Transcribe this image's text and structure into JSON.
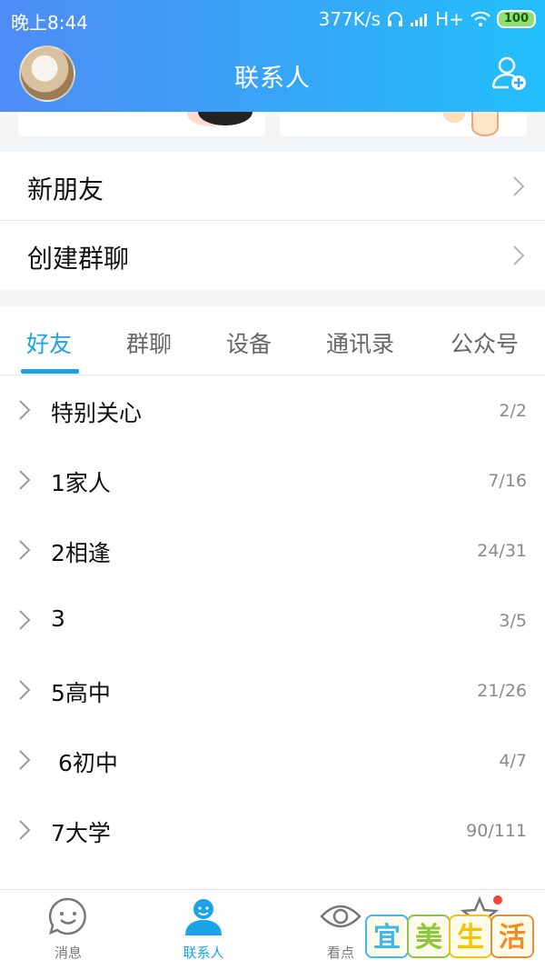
{
  "status_bar": {
    "time": "晚上8:44",
    "speed": "377K/s",
    "network": "H+",
    "battery": "100"
  },
  "header": {
    "title": "联系人"
  },
  "menu": [
    {
      "label": "新朋友"
    },
    {
      "label": "创建群聊"
    }
  ],
  "tabs": [
    {
      "label": "好友",
      "active": true
    },
    {
      "label": "群聊"
    },
    {
      "label": "设备"
    },
    {
      "label": "通讯录"
    },
    {
      "label": "公众号"
    }
  ],
  "groups": [
    {
      "name": "特别关心",
      "count": "2/2"
    },
    {
      "name": "1家人",
      "count": "7/16"
    },
    {
      "name": "2相逢",
      "count": "24/31"
    },
    {
      "name": "3",
      "count": "3/5"
    },
    {
      "name": "5高中",
      "count": "21/26"
    },
    {
      "name": " 6初中",
      "count": "4/7"
    },
    {
      "name": "7大学",
      "count": "90/111"
    }
  ],
  "bottom_nav": [
    {
      "label": "消息",
      "icon": "message-bubble-icon"
    },
    {
      "label": "联系人",
      "icon": "contacts-person-icon",
      "active": true
    },
    {
      "label": "看点",
      "icon": "eye-icon"
    },
    {
      "label": "",
      "icon": "star-icon",
      "badge": true
    }
  ],
  "watermark": {
    "chars": [
      "宜",
      "美",
      "生",
      "活"
    ],
    "colors": [
      "#3db8e8",
      "#8cc63f",
      "#f5c400",
      "#f08c28"
    ]
  },
  "colors": {
    "accent": "#1aa3e8",
    "header_start": "#4f8cf6",
    "header_end": "#22c0fb",
    "badge": "#f44336"
  }
}
